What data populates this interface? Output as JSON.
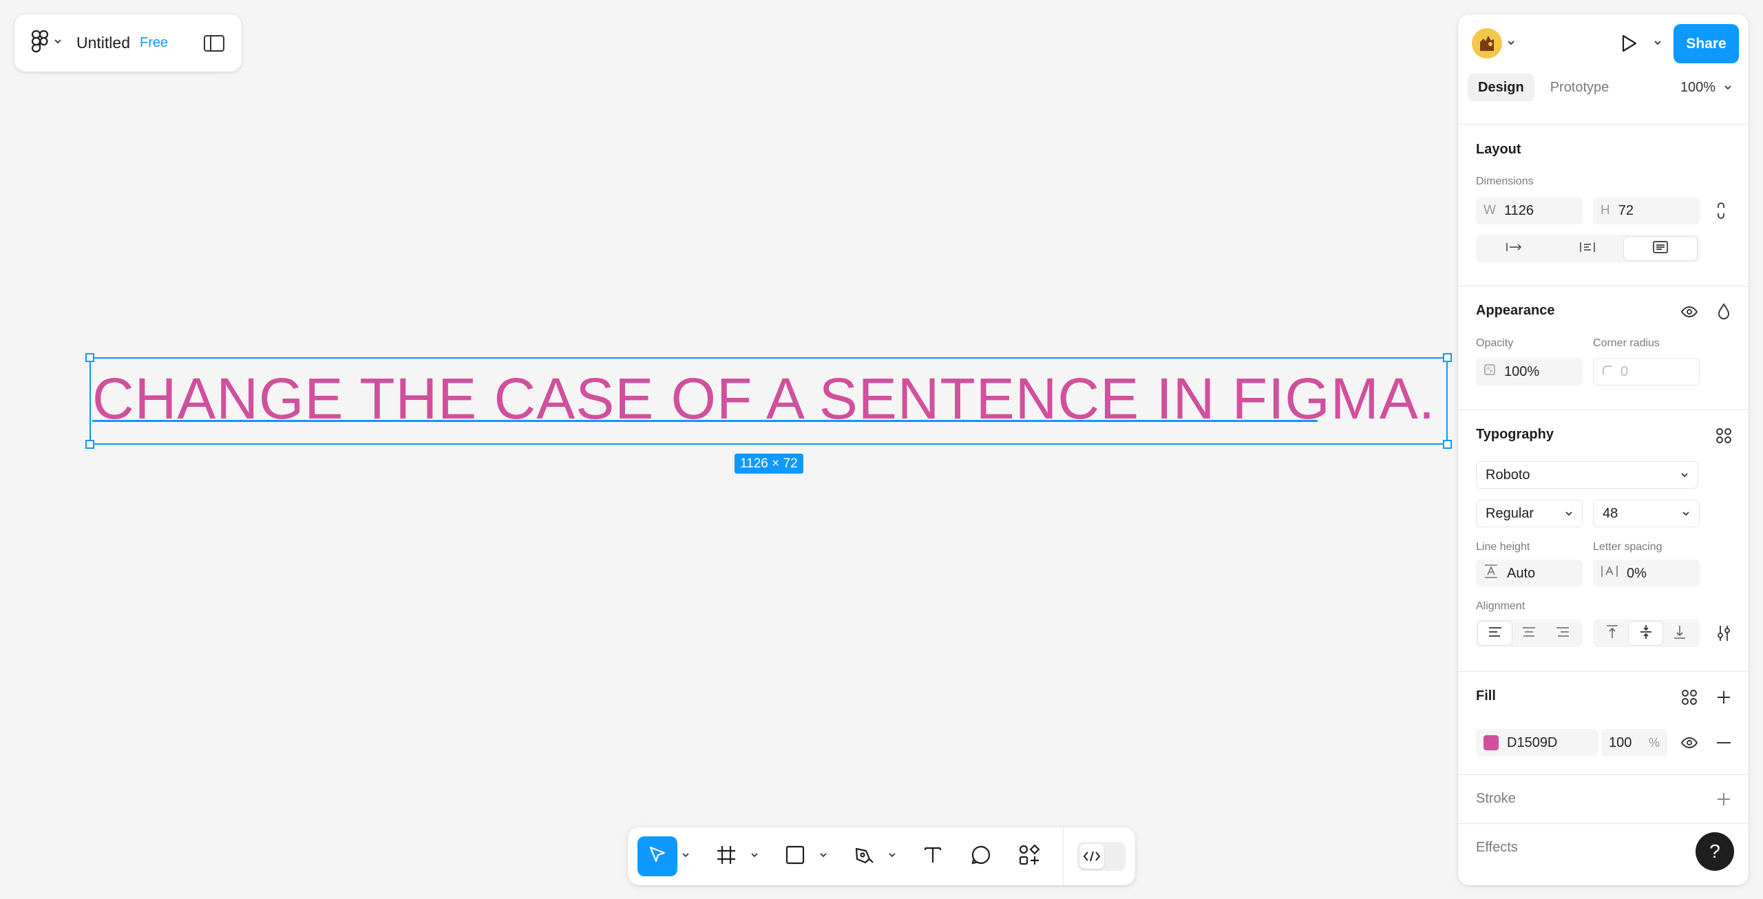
{
  "file": {
    "name": "Untitled",
    "plan": "Free"
  },
  "canvas": {
    "text_content": "CHANGE THE CASE OF A SENTENCE IN FIGMA.",
    "text_color": "#D1509D",
    "selection_size": "1126 × 72"
  },
  "header": {
    "share_label": "Share",
    "tabs": [
      "Design",
      "Prototype"
    ],
    "zoom": "100%"
  },
  "layout": {
    "title": "Layout",
    "dimensions_label": "Dimensions",
    "w_prefix": "W",
    "w_value": "1126",
    "h_prefix": "H",
    "h_value": "72"
  },
  "appearance": {
    "title": "Appearance",
    "opacity_label": "Opacity",
    "opacity_value": "100%",
    "corner_label": "Corner radius",
    "corner_value": "0"
  },
  "typography": {
    "title": "Typography",
    "font_family": "Roboto",
    "font_weight": "Regular",
    "font_size": "48",
    "line_height_label": "Line height",
    "line_height_value": "Auto",
    "letter_spacing_label": "Letter spacing",
    "letter_spacing_value": "0%",
    "alignment_label": "Alignment"
  },
  "fill": {
    "title": "Fill",
    "hex": "D1509D",
    "opacity": "100",
    "unit": "%",
    "swatch_color": "#D1509D"
  },
  "stroke": {
    "title": "Stroke"
  },
  "effects": {
    "title": "Effects"
  },
  "help": {
    "label": "?"
  },
  "colors": {
    "accent": "#0d99ff",
    "text_fill": "#D1509D"
  }
}
